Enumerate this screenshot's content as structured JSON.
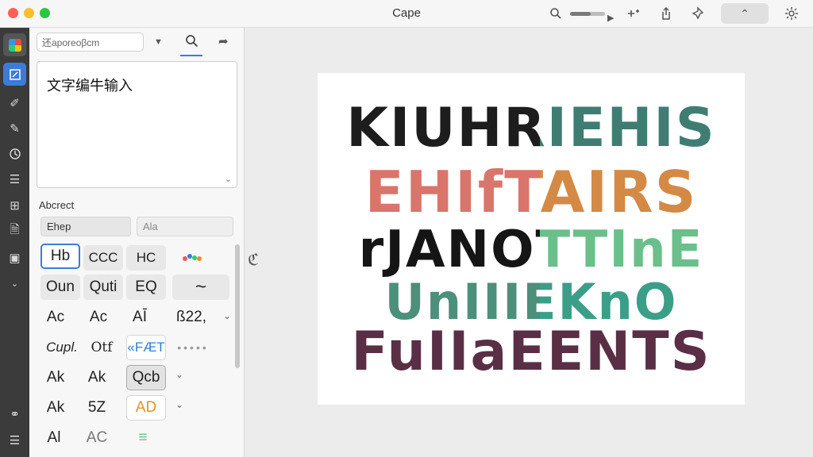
{
  "window": {
    "title": "Cape"
  },
  "toolbar": {
    "zoom_icon": "zoom-icon",
    "zoom_level": 0.6,
    "add_icon": "add-icon",
    "share_icon": "share-icon",
    "bookmark_icon": "pin-icon",
    "collapse_icon": "chevron-up-icon",
    "settings_icon": "gear-icon"
  },
  "sidebar": {
    "items": [
      {
        "name": "app-logo"
      },
      {
        "name": "edit-icon",
        "active": true
      },
      {
        "name": "pen-icon"
      },
      {
        "name": "pencil-icon"
      },
      {
        "name": "clock-icon"
      },
      {
        "name": "list-icon"
      },
      {
        "name": "layout-icon"
      },
      {
        "name": "document-icon"
      },
      {
        "name": "image-icon"
      },
      {
        "name": "chevron-down-icon"
      },
      {
        "name": "link-icon"
      },
      {
        "name": "layers-icon"
      }
    ]
  },
  "panel": {
    "search_value": "还aporeoβcm",
    "text_input": "文字编牛输入",
    "section_label": "Abcrect",
    "field_a": "Ehep",
    "field_b": "Ala",
    "grid": [
      [
        "Hb",
        "CCC",
        "HC",
        ""
      ],
      [
        "Oun",
        "Quti",
        "EQ",
        "~"
      ],
      [
        "Ac",
        "Ac",
        "AĪ",
        "ß22,"
      ],
      [
        "Cupl.",
        "Otf",
        "«FÆT",
        "•••••"
      ],
      [
        "Ak",
        "Ak",
        "Qcb",
        ""
      ],
      [
        "Ak",
        "5Z",
        "AD",
        ""
      ],
      [
        "Al",
        "AC",
        "≡",
        ""
      ]
    ]
  },
  "canvas": {
    "lines": [
      {
        "text": "KIUHRIEHIS",
        "color": "#1d1d1d",
        "accent": "#3f7d72"
      },
      {
        "text": "EHIfTAIRS",
        "color": "#d9756b",
        "accent": "#d48a45"
      },
      {
        "text": "rJANOTTInE",
        "color": "#151515",
        "accent": "#6bbf8a"
      },
      {
        "text": "UnIIIEKnO",
        "color": "#4c8f7a",
        "accent": "#3b9f88"
      },
      {
        "text": "FuIIaEENTS",
        "color": "#5a2f45",
        "accent": "#5a2f45"
      }
    ]
  }
}
